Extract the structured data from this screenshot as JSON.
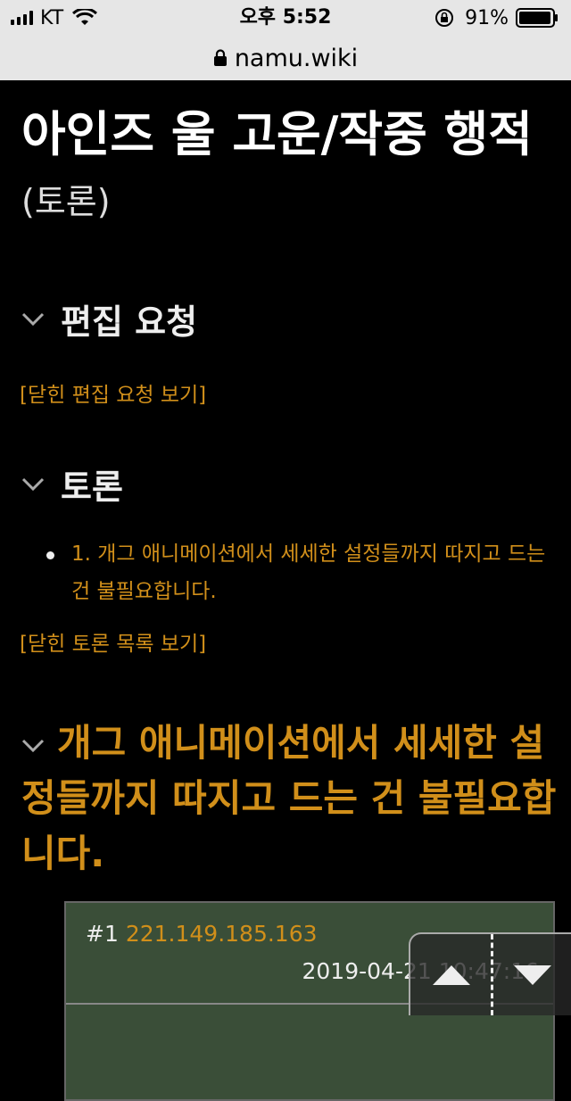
{
  "status_bar": {
    "carrier": "KT",
    "time": "오후 5:52",
    "battery": "91%"
  },
  "url_bar": {
    "domain": "namu.wiki"
  },
  "page": {
    "title": "아인즈 울 고운/작중 행적",
    "title_suffix": "(토론)"
  },
  "edit_requests": {
    "heading": "편집 요청",
    "closed_link": "[닫힌 편집 요청 보기]"
  },
  "discussions": {
    "heading": "토론",
    "items": [
      {
        "label": "1. 개그 애니메이션에서 세세한 설정들까지 따지고 드는 건 불필요합니다."
      }
    ],
    "closed_link": "[닫힌 토론 목록 보기]"
  },
  "thread": {
    "title": "개그 애니메이션에서 세세한 설정들까지 따지고 드는 건 불필요합니다.",
    "comments": [
      {
        "number": "#1",
        "ip": "221.149.185.163",
        "timestamp": "2019-04-21 10:47:16"
      }
    ]
  },
  "colors": {
    "link": "#d18f1a",
    "background": "#000000",
    "comment_bg": "#3a4e38"
  },
  "icons": [
    "signal-icon",
    "wifi-icon",
    "rotation-lock-icon",
    "battery-icon",
    "lock-icon",
    "chevron-down-icon",
    "arrow-up-icon",
    "arrow-down-icon"
  ]
}
